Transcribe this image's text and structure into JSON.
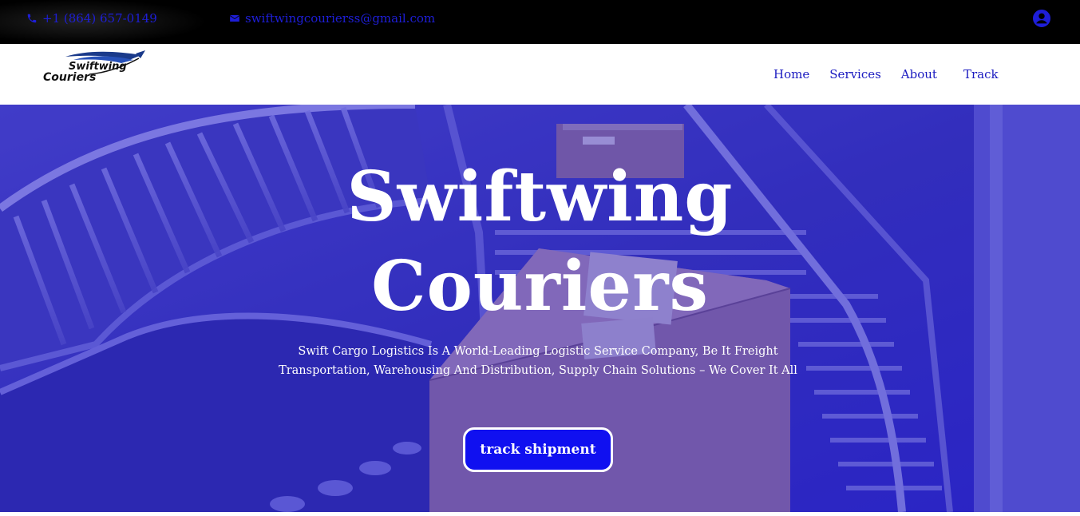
{
  "topbar": {
    "phone": "+1 (864) 657-0149",
    "email": "swiftwingcourierss@gmail.com",
    "phone_icon": "phone-icon",
    "email_icon": "envelope-icon",
    "user_icon": "user-circle-icon"
  },
  "navbar": {
    "logo_line1": "Swiftwing",
    "logo_line2": "Couriers",
    "links": [
      {
        "label": "Home"
      },
      {
        "label": "Services"
      },
      {
        "label": "About"
      },
      {
        "label": "Track"
      }
    ]
  },
  "hero": {
    "title_line1": "Swiftwing",
    "title_line2": "Couriers",
    "subtitle": "Swift Cargo Logistics Is A World-Leading Logistic Service Company, Be It Freight Transportation, Warehousing And Distribution, Supply Chain Solutions – We Cover It All",
    "button_label": "track shipment"
  },
  "colors": {
    "accent": "#1010f0",
    "link": "#1a1ac0",
    "topbar_bg": "#000000",
    "hero_overlay": "#2b24c8"
  }
}
